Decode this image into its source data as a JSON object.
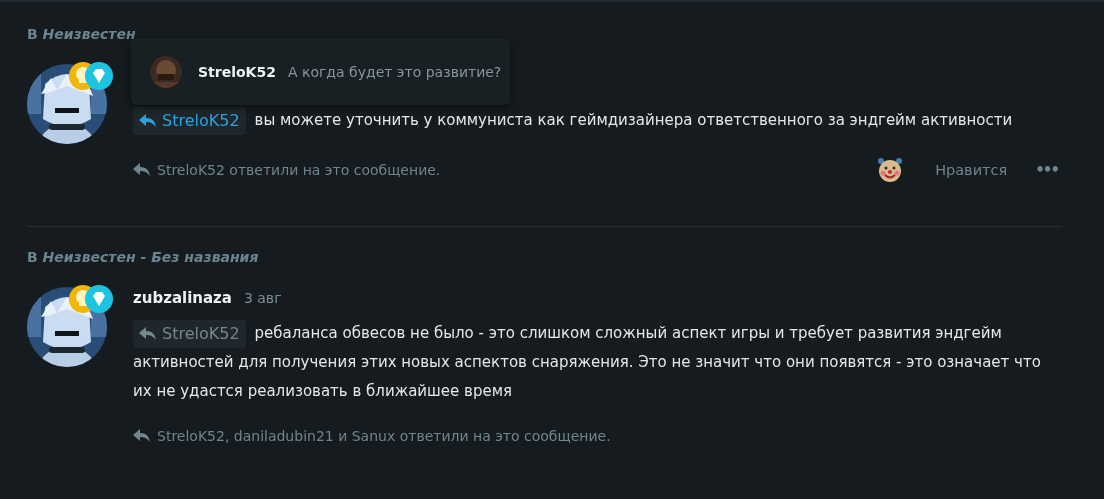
{
  "posts": [
    {
      "header": "В *Неизвестен*",
      "popup": {
        "name": "StreloK52",
        "text": "А когда будет это развитие?"
      },
      "reply_to": {
        "name": "StreloK52",
        "highlighted": true
      },
      "text": "вы можете уточнить у коммуниста как геймдизайнера ответственного за эндгейм активности",
      "replies": "StreloK52 ответили на это сообщение.",
      "actions": {
        "like": "Нравится",
        "more": "•••"
      }
    },
    {
      "header": "В *Неизвестен - Без названия*",
      "author": "zubzalinaza",
      "date": "3 авг",
      "reply_to": {
        "name": "StreloK52",
        "highlighted": false
      },
      "text": "ребаланса обвесов не было - это слишком сложный аспект игры и требует развития эндгейм активностей для получения этих новых аспектов снаряжения. Это не значит что они появятся - это означает что их не удастся реализовать в ближайшее время",
      "replies": "StreloK52, daniladubin21 и Sanux ответили на это сообщение."
    }
  ]
}
